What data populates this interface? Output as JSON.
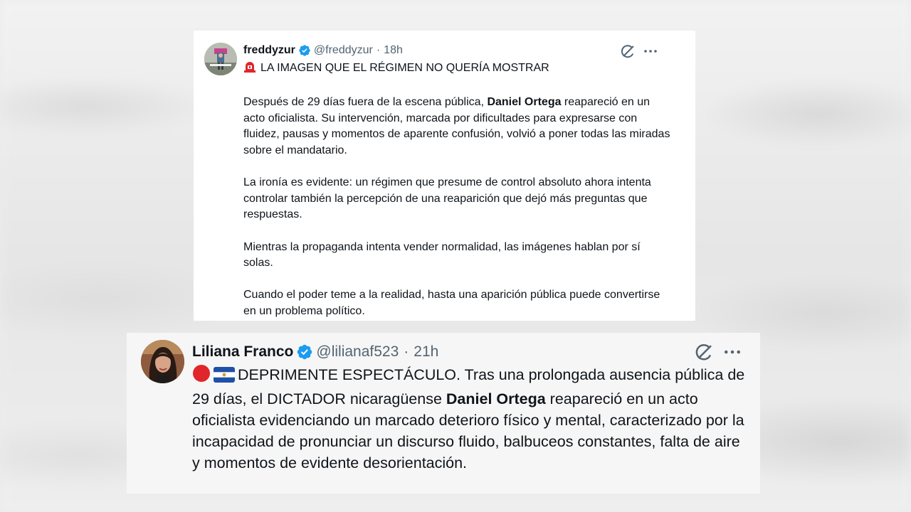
{
  "tweet1": {
    "author_name": "freddyzur",
    "handle": "@freddyzur",
    "separator": "·",
    "time": "18h",
    "icons": {
      "avatar": "avatar-photo",
      "verified": "verified-badge-icon",
      "grok": "grok-icon",
      "more": "more-options-icon",
      "headline_emoji": "police-light-icon"
    },
    "headline": "LA IMAGEN QUE EL RÉGIMEN NO QUERÍA MOSTRAR",
    "p1_before": "Después de 29 días fuera de la escena pública, ",
    "p1_bold": "Daniel Ortega",
    "p1_after": " reapareció en un acto oficialista. Su intervención, marcada por dificultades para expresarse con fluidez, pausas y momentos de aparente confusión, volvió a poner todas las miradas sobre el mandatario.",
    "p2": "La ironía es evidente: un régimen que presume de control absoluto ahora intenta controlar también la percepción de una reaparición que dejó más preguntas que respuestas.",
    "p3": "Mientras la propaganda intenta vender normalidad, las imágenes hablan por sí solas.",
    "p4": "Cuando el poder teme a la realidad, hasta una aparición pública puede convertirse en un problema político."
  },
  "tweet2": {
    "author_name": "Liliana Franco",
    "handle": "@lilianaf523",
    "separator": "·",
    "time": "21h",
    "icons": {
      "avatar": "avatar-photo",
      "verified": "verified-badge-icon",
      "grok": "grok-icon",
      "more": "more-options-icon",
      "emoji1": "red-circle-icon",
      "emoji2": "el-salvador-flag-icon"
    },
    "text_before": "DEPRIMENTE ESPECTÁCULO. Tras una prolongada ausencia pública de 29 días, el DICTADOR nicaragüense ",
    "text_bold": "Daniel Ortega",
    "text_after": " reapareció en un acto oficialista evidenciando un marcado deterioro físico y mental, caracterizado por la incapacidad de pronunciar un discurso fluido, balbuceos constantes, falta de aire y momentos de evidente desorientación."
  },
  "colors": {
    "verified_blue": "#1d9bf0",
    "text_primary": "#0f1419",
    "text_secondary": "#536471",
    "siren_red": "#e0262b",
    "flag_blue": "#1f4fa8"
  }
}
